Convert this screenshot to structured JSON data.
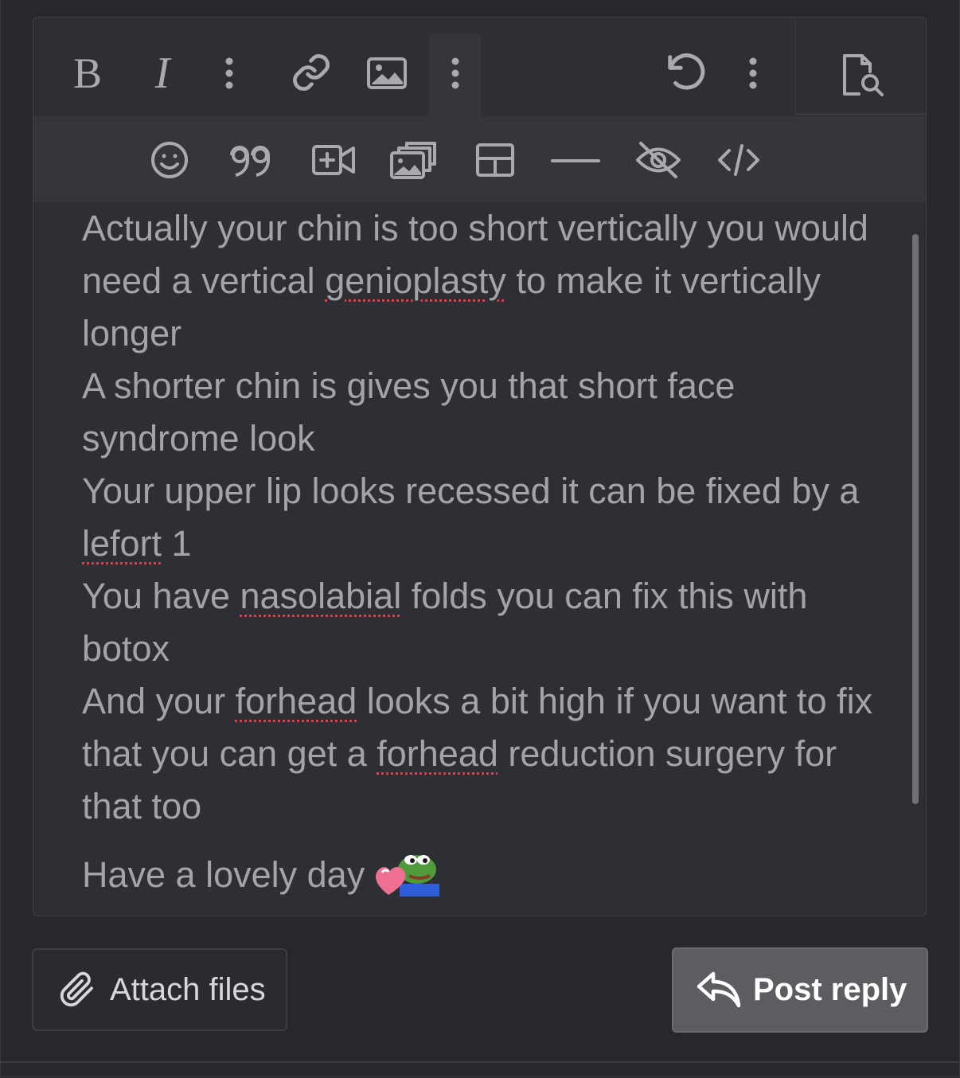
{
  "toolbar": {
    "row1": [
      {
        "name": "bold-icon",
        "label": "B"
      },
      {
        "name": "italic-icon",
        "label": "I"
      },
      {
        "name": "more-text-options-icon"
      },
      {
        "name": "link-icon"
      },
      {
        "name": "image-icon"
      },
      {
        "name": "more-options-icon"
      },
      {
        "name": "undo-icon"
      },
      {
        "name": "more-history-icon"
      },
      {
        "name": "preview-icon"
      }
    ],
    "row2": [
      {
        "name": "smiley-icon"
      },
      {
        "name": "quote-icon"
      },
      {
        "name": "insert-media-icon"
      },
      {
        "name": "gallery-icon"
      },
      {
        "name": "table-icon"
      },
      {
        "name": "horizontal-rule-icon"
      },
      {
        "name": "spoiler-icon"
      },
      {
        "name": "code-icon"
      }
    ]
  },
  "message": {
    "paragraphs": [
      {
        "segments": [
          {
            "text": "Actually your chin is too short vertically you would need a vertical "
          },
          {
            "text": "genioplasty",
            "misspelled": true
          },
          {
            "text": " to make it vertically longer"
          }
        ]
      },
      {
        "segments": [
          {
            "text": "A shorter chin is gives you that short face syndrome look"
          }
        ]
      },
      {
        "segments": [
          {
            "text": "Your upper lip looks recessed it can be fixed by a "
          },
          {
            "text": "lefort",
            "misspelled": true
          },
          {
            "text": " 1"
          }
        ]
      },
      {
        "segments": [
          {
            "text": "You have "
          },
          {
            "text": "nasolabial",
            "misspelled": true
          },
          {
            "text": " folds you can fix this with botox"
          }
        ]
      },
      {
        "segments": [
          {
            "text": "And your "
          },
          {
            "text": "forhead",
            "misspelled": true
          },
          {
            "text": " looks a bit high if you want to fix that you can get a "
          },
          {
            "text": "forhead",
            "misspelled": true
          },
          {
            "text": " reduction surgery for that too"
          }
        ]
      }
    ],
    "closing": "Have a lovely day",
    "closing_emoji": "pepe-heart-emoji"
  },
  "actions": {
    "attach_label": "Attach files",
    "post_label": "Post reply"
  }
}
